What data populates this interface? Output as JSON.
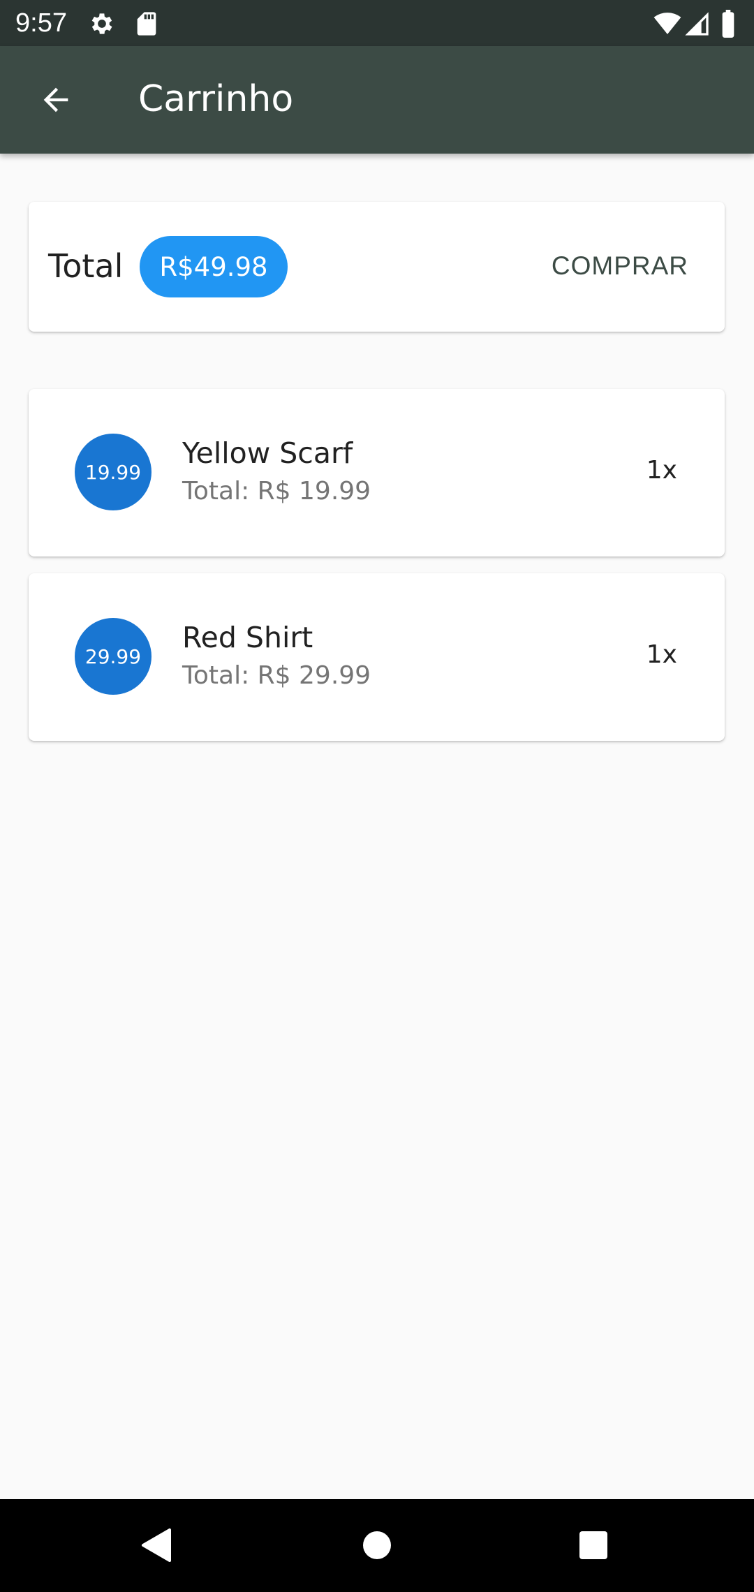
{
  "status_bar": {
    "time": "9:57",
    "icons": [
      "gear-icon",
      "sd-card-icon",
      "wifi-icon",
      "signal-icon",
      "battery-icon"
    ]
  },
  "app_bar": {
    "title": "Carrinho",
    "back_icon": "arrow-back-icon"
  },
  "cart_total": {
    "label": "Total",
    "amount": "R$49.98",
    "buy_label": "COMPRAR"
  },
  "items": [
    {
      "price_badge": "19.99",
      "name": "Yellow Scarf",
      "total": "Total: R$ 19.99",
      "quantity": "1x"
    },
    {
      "price_badge": "29.99",
      "name": "Red Shirt",
      "total": "Total: R$ 29.99",
      "quantity": "1x"
    }
  ],
  "nav_bar": {
    "icons": [
      "back-triangle-icon",
      "home-circle-icon",
      "recents-square-icon"
    ]
  },
  "colors": {
    "status_bar": "#2b3532",
    "app_bar": "#3c4b45",
    "total_badge": "#2196f3",
    "price_avatar": "#1976d2",
    "background": "#fafafa"
  }
}
